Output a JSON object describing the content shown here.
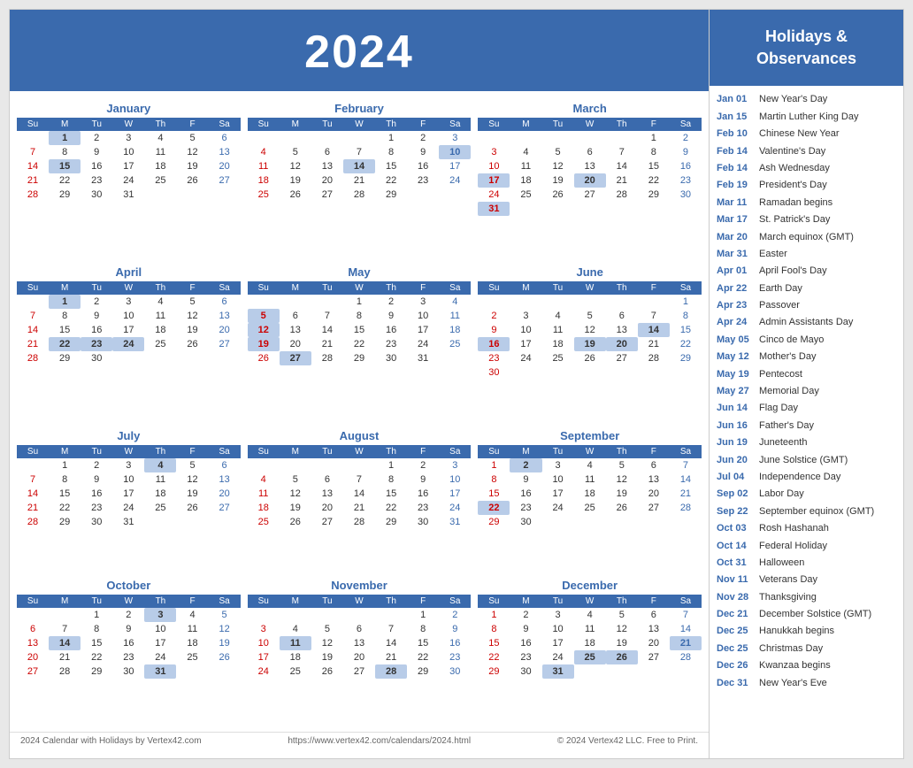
{
  "header": {
    "year": "2024",
    "title": "Holidays & Observances"
  },
  "footer": {
    "left": "2024 Calendar with Holidays by Vertex42.com",
    "center": "https://www.vertex42.com/calendars/2024.html",
    "right": "© 2024 Vertex42 LLC. Free to Print."
  },
  "months": [
    {
      "name": "January",
      "startDay": 1,
      "days": 31,
      "highlighted": [
        1,
        15
      ],
      "today": []
    },
    {
      "name": "February",
      "startDay": 4,
      "days": 29,
      "highlighted": [
        10,
        14
      ],
      "today": []
    },
    {
      "name": "March",
      "startDay": 5,
      "days": 31,
      "highlighted": [
        17,
        20,
        31
      ],
      "today": []
    },
    {
      "name": "April",
      "startDay": 1,
      "days": 30,
      "highlighted": [
        1,
        22,
        23,
        24
      ],
      "today": []
    },
    {
      "name": "May",
      "startDay": 3,
      "days": 31,
      "highlighted": [
        5,
        12,
        19,
        27
      ],
      "today": []
    },
    {
      "name": "June",
      "startDay": 6,
      "days": 30,
      "highlighted": [
        14,
        16,
        19,
        20
      ],
      "today": []
    },
    {
      "name": "July",
      "startDay": 1,
      "days": 31,
      "highlighted": [
        4
      ],
      "today": []
    },
    {
      "name": "August",
      "startDay": 4,
      "days": 31,
      "highlighted": [],
      "today": []
    },
    {
      "name": "September",
      "startDay": 0,
      "days": 30,
      "highlighted": [
        2,
        22
      ],
      "today": []
    },
    {
      "name": "October",
      "startDay": 2,
      "days": 31,
      "highlighted": [
        3,
        14,
        31
      ],
      "today": []
    },
    {
      "name": "November",
      "startDay": 5,
      "days": 30,
      "highlighted": [
        11,
        28
      ],
      "today": []
    },
    {
      "name": "December",
      "startDay": 0,
      "days": 31,
      "highlighted": [
        21,
        25,
        26,
        31
      ],
      "today": []
    }
  ],
  "holidays": [
    {
      "date": "Jan 01",
      "name": "New Year's Day"
    },
    {
      "date": "Jan 15",
      "name": "Martin Luther King Day"
    },
    {
      "date": "Feb 10",
      "name": "Chinese New Year"
    },
    {
      "date": "Feb 14",
      "name": "Valentine's Day"
    },
    {
      "date": "Feb 14",
      "name": "Ash Wednesday"
    },
    {
      "date": "Feb 19",
      "name": "President's Day"
    },
    {
      "date": "Mar 11",
      "name": "Ramadan begins"
    },
    {
      "date": "Mar 17",
      "name": "St. Patrick's Day"
    },
    {
      "date": "Mar 20",
      "name": "March equinox (GMT)"
    },
    {
      "date": "Mar 31",
      "name": "Easter"
    },
    {
      "date": "Apr 01",
      "name": "April Fool's Day"
    },
    {
      "date": "Apr 22",
      "name": "Earth Day"
    },
    {
      "date": "Apr 23",
      "name": "Passover"
    },
    {
      "date": "Apr 24",
      "name": "Admin Assistants Day"
    },
    {
      "date": "May 05",
      "name": "Cinco de Mayo"
    },
    {
      "date": "May 12",
      "name": "Mother's Day"
    },
    {
      "date": "May 19",
      "name": "Pentecost"
    },
    {
      "date": "May 27",
      "name": "Memorial Day"
    },
    {
      "date": "Jun 14",
      "name": "Flag Day"
    },
    {
      "date": "Jun 16",
      "name": "Father's Day"
    },
    {
      "date": "Jun 19",
      "name": "Juneteenth"
    },
    {
      "date": "Jun 20",
      "name": "June Solstice (GMT)"
    },
    {
      "date": "Jul 04",
      "name": "Independence Day"
    },
    {
      "date": "Sep 02",
      "name": "Labor Day"
    },
    {
      "date": "Sep 22",
      "name": "September equinox (GMT)"
    },
    {
      "date": "Oct 03",
      "name": "Rosh Hashanah"
    },
    {
      "date": "Oct 14",
      "name": "Federal Holiday"
    },
    {
      "date": "Oct 31",
      "name": "Halloween"
    },
    {
      "date": "Nov 11",
      "name": "Veterans Day"
    },
    {
      "date": "Nov 28",
      "name": "Thanksgiving"
    },
    {
      "date": "Dec 21",
      "name": "December Solstice (GMT)"
    },
    {
      "date": "Dec 25",
      "name": "Hanukkah begins"
    },
    {
      "date": "Dec 25",
      "name": "Christmas Day"
    },
    {
      "date": "Dec 26",
      "name": "Kwanzaa begins"
    },
    {
      "date": "Dec 31",
      "name": "New Year's Eve"
    }
  ]
}
